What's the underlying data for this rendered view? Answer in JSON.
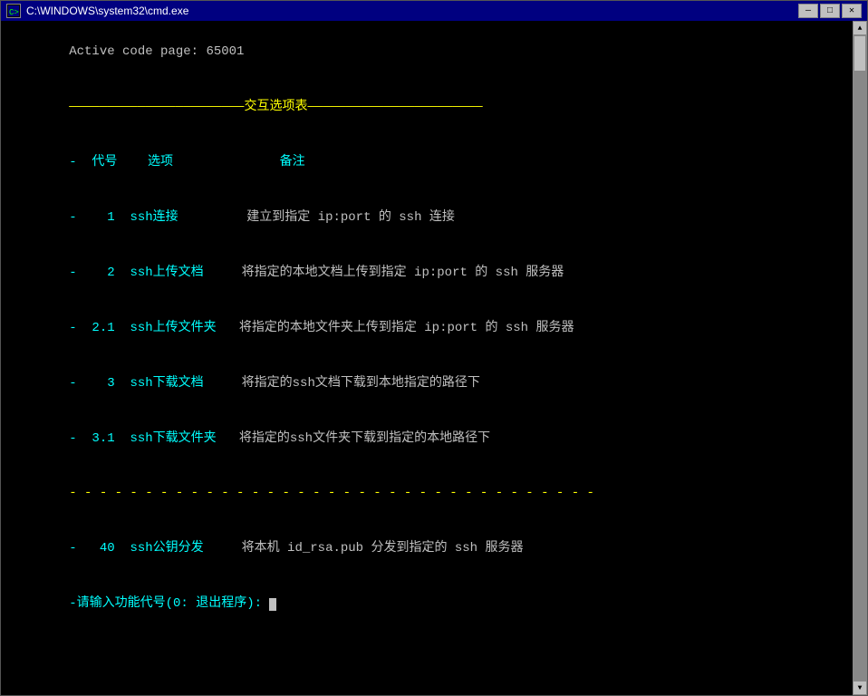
{
  "titlebar": {
    "icon_label": "cmd-icon",
    "title": "C:\\WINDOWS\\system32\\cmd.exe",
    "minimize_label": "—",
    "maximize_label": "□",
    "close_label": "✕"
  },
  "console": {
    "active_code_page": "Active code page: 65001",
    "menu_header": "———————————————————————交互选项表———————————————————————",
    "col_header": "-  代号    选项              备注",
    "rows": [
      {
        "code": "-    1",
        "cmd": "ssh连接        ",
        "desc": "建立到指定 ip:port 的 ssh 连接"
      },
      {
        "code": "-    2",
        "cmd": "ssh上传文档    ",
        "desc": "将指定的本地文档上传到指定 ip:port 的 ssh 服务器"
      },
      {
        "code": "-  2.1",
        "cmd": "ssh上传文件夹  ",
        "desc": "将指定的本地文件夹上传到指定 ip:port 的 ssh 服务器"
      },
      {
        "code": "-    3",
        "cmd": "ssh下载文档    ",
        "desc": "将指定的ssh文档下载到本地指定的路径下"
      },
      {
        "code": "-  3.1",
        "cmd": "ssh下载文件夹  ",
        "desc": "将指定的ssh文件夹下载到指定的本地路径下"
      }
    ],
    "separator": "- - - - - - - - - - - - - - - - - - - - - - - - - - - - - - - - - - -",
    "extra_row": {
      "code": "-   40",
      "cmd": "ssh公钥分发    ",
      "desc": "将本机 id_rsa.pub 分发到指定的 ssh 服务器"
    },
    "prompt": "-请输入功能代号(0: 退出程序): "
  }
}
